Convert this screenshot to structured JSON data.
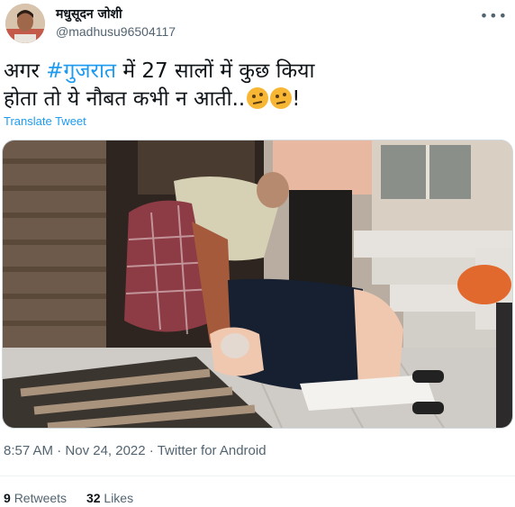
{
  "author": {
    "display_name": "मधुसूदन जोशी",
    "handle": "@madhusu96504117"
  },
  "more_icon": "more-horizontal-icon",
  "tweet": {
    "text_before": "अगर ",
    "hashtag": "#गुजरात",
    "text_after_line1": " में 27 सालों में कुछ किया",
    "text_line2": "होता तो ये नौबत कभी न आती..",
    "emoji_names": [
      "thinking-face-icon",
      "thinking-face-icon"
    ],
    "text_end": "!"
  },
  "translate_label": "Translate Tweet",
  "meta": {
    "time": "8:57 AM",
    "sep1": " · ",
    "date": "Nov 24, 2022",
    "sep2": " · ",
    "source": "Twitter for Android"
  },
  "stats": {
    "retweets_count": "9",
    "retweets_label": "Retweets",
    "likes_count": "32",
    "likes_label": "Likes"
  },
  "colors": {
    "link": "#1d9bf0",
    "secondary": "#536471",
    "text": "#0f1419"
  }
}
